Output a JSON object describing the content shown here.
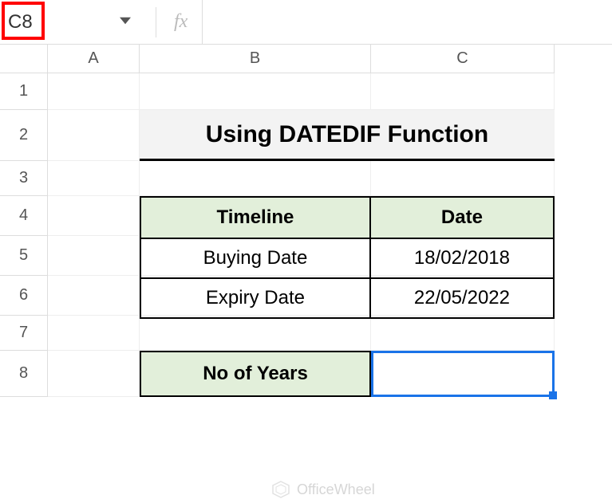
{
  "name_box": "C8",
  "formula_input": "",
  "columns": [
    "A",
    "B",
    "C"
  ],
  "rows": [
    "1",
    "2",
    "3",
    "4",
    "5",
    "6",
    "7",
    "8"
  ],
  "title": "Using DATEDIF Function",
  "table": {
    "headers": {
      "timeline": "Timeline",
      "date": "Date"
    },
    "rows": [
      {
        "timeline": "Buying Date",
        "date": "18/02/2018"
      },
      {
        "timeline": "Expiry Date",
        "date": "22/05/2022"
      }
    ]
  },
  "years_label": "No of Years",
  "years_value": "",
  "watermark": "OfficeWheel"
}
